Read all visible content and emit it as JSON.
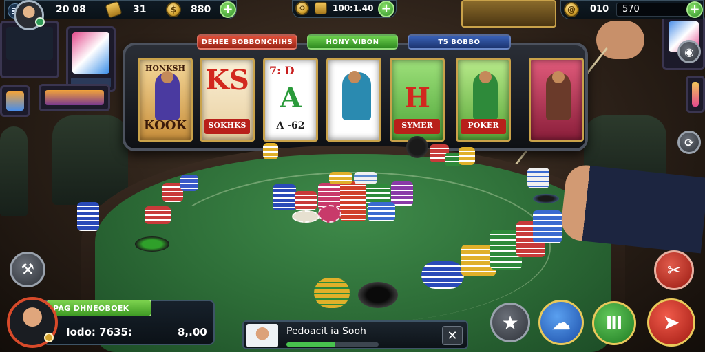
{
  "top_hud": {
    "menu_icon": "menu-icon",
    "level": "20 08",
    "chips_count": "31",
    "coins_count": "880",
    "center_value": "100:1.40",
    "right_label": "010",
    "right_money": "570"
  },
  "slot": {
    "tabs": [
      "DEHEE BOBBONCHIHS",
      "HONY VIBON",
      "T5 BOBBO"
    ],
    "reels": [
      {
        "top": "HONKSH",
        "big": "",
        "bottom": "KOOK"
      },
      {
        "top": "",
        "big": "KS",
        "bottom": "SOKHKS"
      },
      {
        "top": "7: D",
        "big": "A",
        "bottom": "A ‑62"
      },
      {
        "top": "",
        "big": "",
        "bottom": ""
      },
      {
        "top": "",
        "big": "H",
        "bottom": "SYMER"
      },
      {
        "top": "",
        "big": "",
        "bottom": "POKER"
      },
      {
        "top": "",
        "big": "",
        "bottom": ""
      }
    ]
  },
  "player": {
    "name": "PAG DHNEOBOEK",
    "label": "Iodo: 7635:",
    "amount": "8,.00"
  },
  "notification": {
    "text": "Pedoacit ia Sooh",
    "progress": 0.52
  },
  "colors": {
    "accent_green": "#48c24e",
    "accent_red": "#c9281f",
    "accent_blue": "#2f73d6",
    "felt": "#2c6b36"
  }
}
